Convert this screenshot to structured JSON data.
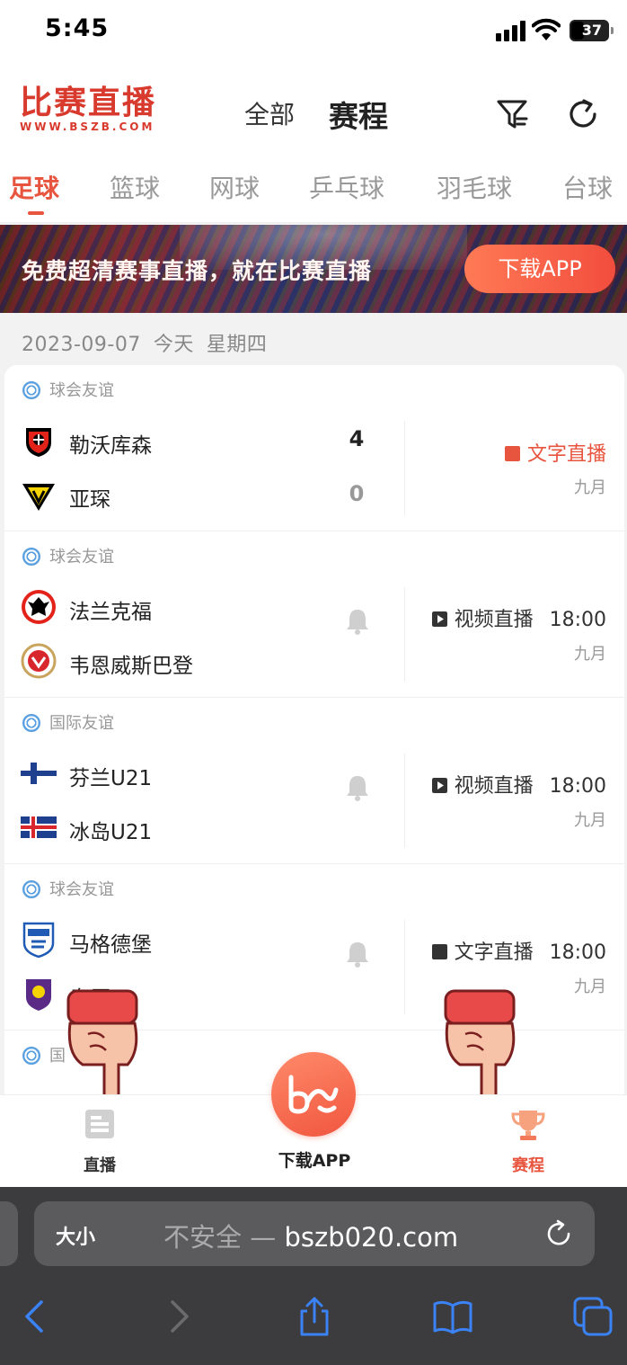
{
  "status_bar": {
    "time": "5:45",
    "battery": "37"
  },
  "header": {
    "logo_main": "比赛直播",
    "logo_sub": "WWW.BSZB.COM",
    "mode_all": "全部",
    "mode_schedule": "赛程",
    "filter_icon": "filter-icon",
    "refresh_icon": "refresh-icon"
  },
  "sport_tabs": [
    {
      "label": "足球",
      "active": true
    },
    {
      "label": "篮球"
    },
    {
      "label": "网球"
    },
    {
      "label": "乒乓球"
    },
    {
      "label": "羽毛球"
    },
    {
      "label": "台球"
    }
  ],
  "banner": {
    "slogan": "免费超清赛事直播，就在比赛直播",
    "button": "下载APP"
  },
  "date": {
    "date": "2023-09-07",
    "relative": "今天",
    "weekday": "星期四"
  },
  "matches": [
    {
      "league": "球会友谊",
      "home": {
        "name": "勒沃库森",
        "score": "4"
      },
      "away": {
        "name": "亚琛",
        "score": "0"
      },
      "live_label": "文字直播",
      "time": "",
      "month": "九月"
    },
    {
      "league": "球会友谊",
      "home": {
        "name": "法兰克福"
      },
      "away": {
        "name": "韦恩威斯巴登"
      },
      "live_label": "视频直播",
      "time": "18:00",
      "month": "九月"
    },
    {
      "league": "国际友谊",
      "home": {
        "name": "芬兰U21"
      },
      "away": {
        "name": "冰岛U21"
      },
      "live_label": "视频直播",
      "time": "18:00",
      "month": "九月"
    },
    {
      "league": "球会友谊",
      "home": {
        "name": "马格德堡"
      },
      "away": {
        "name": "奥厄"
      },
      "live_label": "文字直播",
      "time": "18:00",
      "month": "九月"
    },
    {
      "league": "国"
    }
  ],
  "bottom_tabs": {
    "live": "直播",
    "download": "下载APP",
    "schedule": "赛程"
  },
  "browser": {
    "text_size": "大小",
    "insecure": "不安全",
    "separator": " — ",
    "domain": "bszb020.com"
  },
  "colors": {
    "accent": "#e8553f",
    "brand_red": "#d93a2e"
  }
}
